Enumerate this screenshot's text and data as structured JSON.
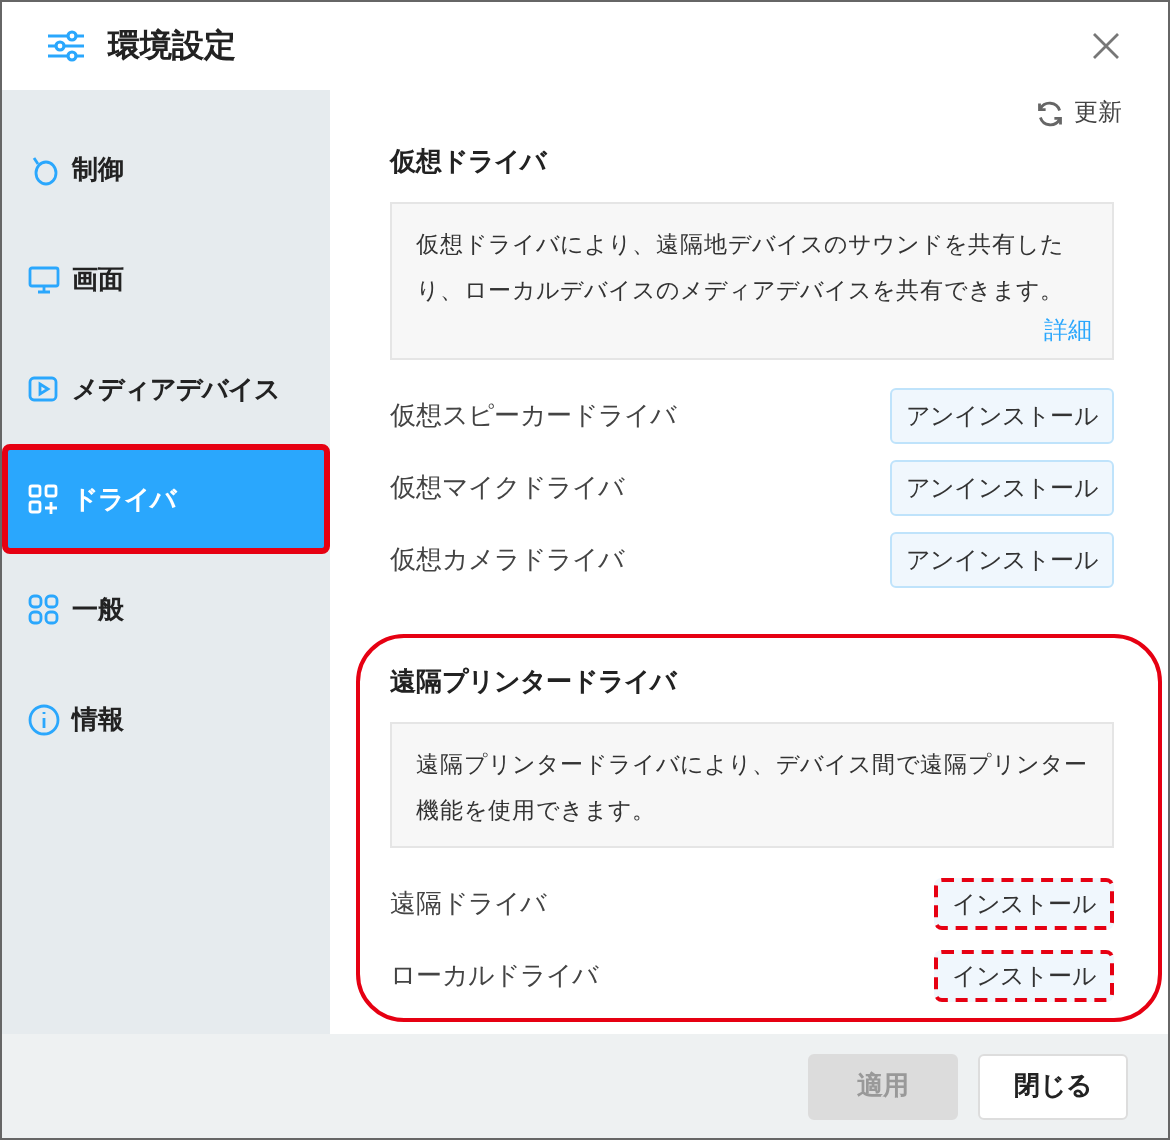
{
  "window": {
    "title": "環境設定"
  },
  "sidebar": {
    "items": [
      {
        "label": "制御",
        "selected": false,
        "highlighted": false
      },
      {
        "label": "画面",
        "selected": false,
        "highlighted": false
      },
      {
        "label": "メディアデバイス",
        "selected": false,
        "highlighted": false
      },
      {
        "label": "ドライバ",
        "selected": true,
        "highlighted": true
      },
      {
        "label": "一般",
        "selected": false,
        "highlighted": false
      },
      {
        "label": "情報",
        "selected": false,
        "highlighted": false
      }
    ]
  },
  "content": {
    "refresh": "更新",
    "sections": [
      {
        "title": "仮想ドライバ",
        "description": "仮想ドライバにより、遠隔地デバイスのサウンドを共有したり、ローカルデバイスのメディアデバイスを共有できます。",
        "link": "詳細",
        "highlighted": false,
        "rows": [
          {
            "label": "仮想スピーカードライバ",
            "button": "アンインストール",
            "highlighted": false
          },
          {
            "label": "仮想マイクドライバ",
            "button": "アンインストール",
            "highlighted": false
          },
          {
            "label": "仮想カメラドライバ",
            "button": "アンインストール",
            "highlighted": false
          }
        ]
      },
      {
        "title": "遠隔プリンタードライバ",
        "description": "遠隔プリンタードライバにより、デバイス間で遠隔プリンター機能を使用できます。",
        "highlighted": true,
        "rows": [
          {
            "label": "遠隔ドライバ",
            "button": "インストール",
            "highlighted": true
          },
          {
            "label": "ローカルドライバ",
            "button": "インストール",
            "highlighted": true
          }
        ]
      }
    ]
  },
  "footer": {
    "buttons": [
      {
        "label": "適用",
        "disabled": true
      },
      {
        "label": "閉じる",
        "disabled": false
      }
    ]
  }
}
